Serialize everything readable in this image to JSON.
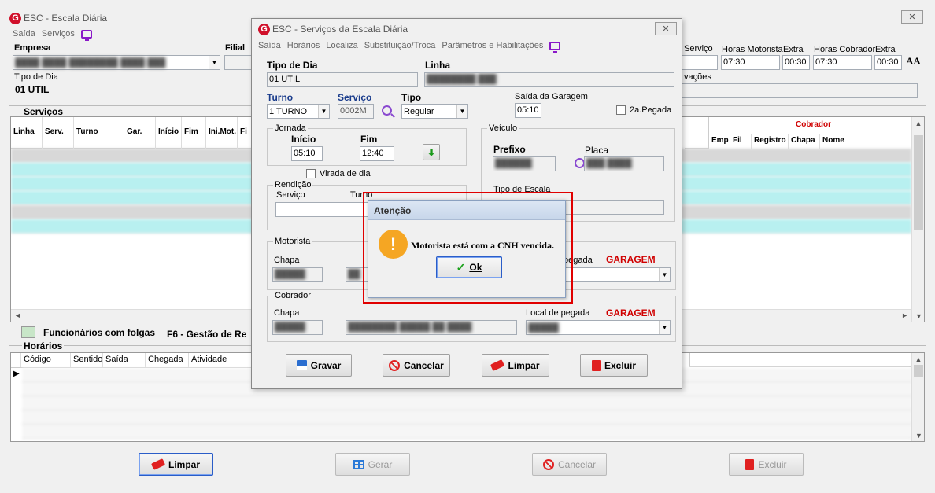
{
  "main_window": {
    "title": "ESC - Escala Diária",
    "menu": [
      "Saída",
      "Serviços"
    ],
    "empresa_label": "Empresa",
    "filial_label": "Filial",
    "tipo_dia_label": "Tipo de Dia",
    "tipo_dia_value": "01 UTIL",
    "servicos_section": "Serviços",
    "servicos_columns": [
      "Linha",
      "Serv.",
      "Turno",
      "Gar.",
      "Início",
      "Fim",
      "Ini.Mot.",
      "Fi"
    ],
    "cobrador_header": "Cobrador",
    "cobrador_columns": [
      "Emp",
      "Fil",
      "Registro",
      "Chapa",
      "Nome"
    ],
    "servico_label": "Serviço",
    "horas_motorista_label": "Horas Motorista",
    "horas_motorista_value": "07:30",
    "extra_label_1": "Extra",
    "extra_value_1": "00:30",
    "horas_cobrador_label": "Horas Cobrador",
    "horas_cobrador_value": "07:30",
    "extra_label_2": "Extra",
    "extra_value_2": "00:30",
    "font_toggle": "AA",
    "observacoes_partial": "vações",
    "legend_folgas": "Funcionários com folgas",
    "legend_f6": "F6 - Gestão de Re",
    "horarios_section": "Horários",
    "horarios_columns": [
      "Código",
      "Sentido",
      "Saída",
      "Chegada",
      "Atividade"
    ],
    "buttons": {
      "limpar": "Limpar",
      "gerar": "Gerar",
      "cancelar": "Cancelar",
      "excluir": "Excluir"
    }
  },
  "dialog": {
    "title": "ESC - Serviços da Escala Diária",
    "menu": [
      "Saída",
      "Horários",
      "Localiza",
      "Substituição/Troca",
      "Parâmetros e Habilitações"
    ],
    "tipo_dia_label": "Tipo de Dia",
    "tipo_dia_value": "01 UTIL",
    "linha_label": "Linha",
    "turno_label": "Turno",
    "turno_value": "1 TURNO",
    "servico_label": "Serviço",
    "servico_value": "0002M",
    "tipo_label": "Tipo",
    "tipo_value": "Regular",
    "saida_garagem_label": "Saída da Garagem",
    "saida_garagem_value": "05:10",
    "segunda_pegada_label": "2a.Pegada",
    "jornada_label": "Jornada",
    "inicio_label": "Início",
    "inicio_value": "05:10",
    "fim_label": "Fim",
    "fim_value": "12:40",
    "virada_dia_label": "Virada de dia",
    "rendicao_label": "Rendição",
    "rendicao_servico_label": "Serviço",
    "rendicao_turno_label": "Turno",
    "veiculo_label": "Veículo",
    "prefixo_label": "Prefixo",
    "placa_label": "Placa",
    "tipo_escala_partial": "Tipo de Escala",
    "motorista_label": "Motorista",
    "motorista_chapa_label": "Chapa",
    "motorista_pegada_label": "pegada",
    "garagem_1": "GARAGEM",
    "cobrador_label": "Cobrador",
    "cobrador_chapa_label": "Chapa",
    "cobrador_local_label": "Local de pegada",
    "garagem_2": "GARAGEM",
    "buttons": {
      "gravar": "Gravar",
      "cancelar": "Cancelar",
      "limpar": "Limpar",
      "excluir": "Excluir"
    }
  },
  "alert": {
    "title": "Atenção",
    "message": "Motorista está com a CNH vencida.",
    "ok_label": "Ok",
    "icon_glyph": "!"
  },
  "colors": {
    "highlight_row": "#b8f0f0",
    "alert_border": "#e00000",
    "warning_icon": "#f5a623",
    "garagem_red": "#d00000"
  }
}
